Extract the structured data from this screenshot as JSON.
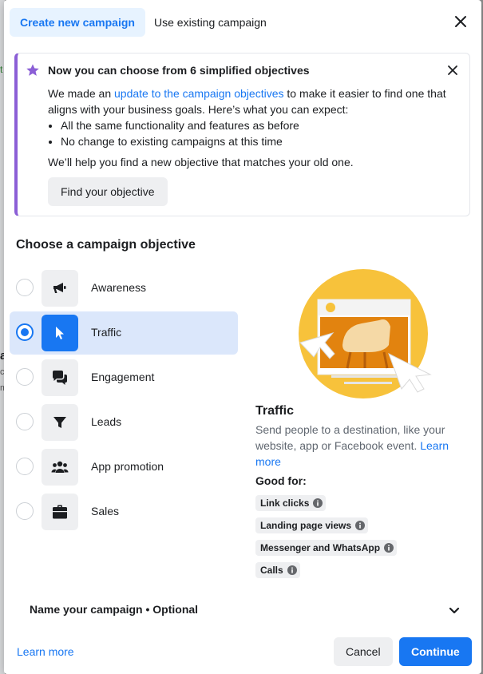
{
  "background_fragments": [
    "t",
    "a",
    "ca",
    "m"
  ],
  "tabs": [
    {
      "label": "Create new campaign"
    },
    {
      "label": "Use existing campaign"
    }
  ],
  "banner": {
    "title": "Now you can choose from 6 simplified objectives",
    "intro_before_link": "We made an ",
    "link_text": "update to the campaign objectives",
    "intro_after_link": " to make it easier to find one that aligns with your business goals. Here’s what you can expect:",
    "bullets": [
      "All the same functionality and features as before",
      "No change to existing campaigns at this time"
    ],
    "help_text": "We’ll help you find a new objective that matches your old one.",
    "button_label": "Find your objective"
  },
  "section_title": "Choose a campaign objective",
  "objectives": [
    {
      "label": "Awareness",
      "icon": "megaphone-icon",
      "selected": false
    },
    {
      "label": "Traffic",
      "icon": "cursor-icon",
      "selected": true
    },
    {
      "label": "Engagement",
      "icon": "chat-bubbles-icon",
      "selected": false
    },
    {
      "label": "Leads",
      "icon": "funnel-icon",
      "selected": false
    },
    {
      "label": "App promotion",
      "icon": "people-icon",
      "selected": false
    },
    {
      "label": "Sales",
      "icon": "briefcase-icon",
      "selected": false
    }
  ],
  "detail": {
    "title": "Traffic",
    "description": "Send people to a destination, like your website, app or Facebook event.",
    "learn_more": "Learn more",
    "good_for_label": "Good for:",
    "good_for": [
      "Link clicks",
      "Landing page views",
      "Messenger and WhatsApp",
      "Calls"
    ]
  },
  "name_campaign": {
    "label": "Name your campaign • Optional"
  },
  "footer": {
    "learn_more": "Learn more",
    "cancel": "Cancel",
    "continue": "Continue"
  },
  "colors": {
    "accent": "#1877f2",
    "accent_light": "#e7f3ff",
    "selected_row": "#dbe7fb",
    "banner_border": "#8b5fd6",
    "neutral_button": "#eeeff1",
    "illustration_yellow": "#f7c23b",
    "illustration_orange": "#e2830f"
  }
}
